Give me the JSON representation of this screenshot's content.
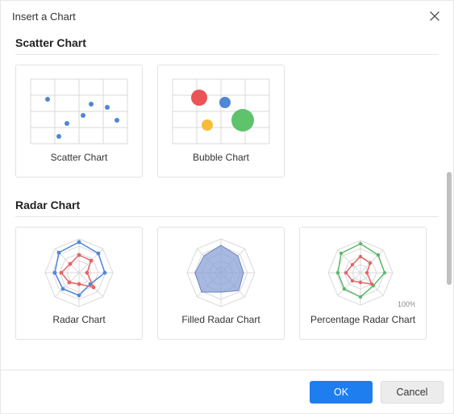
{
  "dialog": {
    "title": "Insert a Chart"
  },
  "sections": {
    "scatter": {
      "title": "Scatter Chart",
      "cards": [
        {
          "label": "Scatter Chart"
        },
        {
          "label": "Bubble Chart"
        }
      ]
    },
    "radar": {
      "title": "Radar Chart",
      "cards": [
        {
          "label": "Radar Chart"
        },
        {
          "label": "Filled Radar Chart"
        },
        {
          "label": "Percentage Radar Chart",
          "badge": "100%"
        }
      ]
    }
  },
  "footer": {
    "ok": "OK",
    "cancel": "Cancel"
  },
  "icons": {
    "close": "close-icon"
  },
  "colors": {
    "primary": "#1e7ef0",
    "grid": "#d9d9d9",
    "scatter_point": "#4f86d8",
    "bubble_red": "#ea5455",
    "bubble_blue": "#4f86d8",
    "bubble_yellow": "#f5bd3a",
    "bubble_green": "#5ec36b",
    "radar_red": "#e06666",
    "radar_blue": "#4f86d8",
    "radar_green": "#5bb96b",
    "radar_fill": "#8aa2d6"
  }
}
